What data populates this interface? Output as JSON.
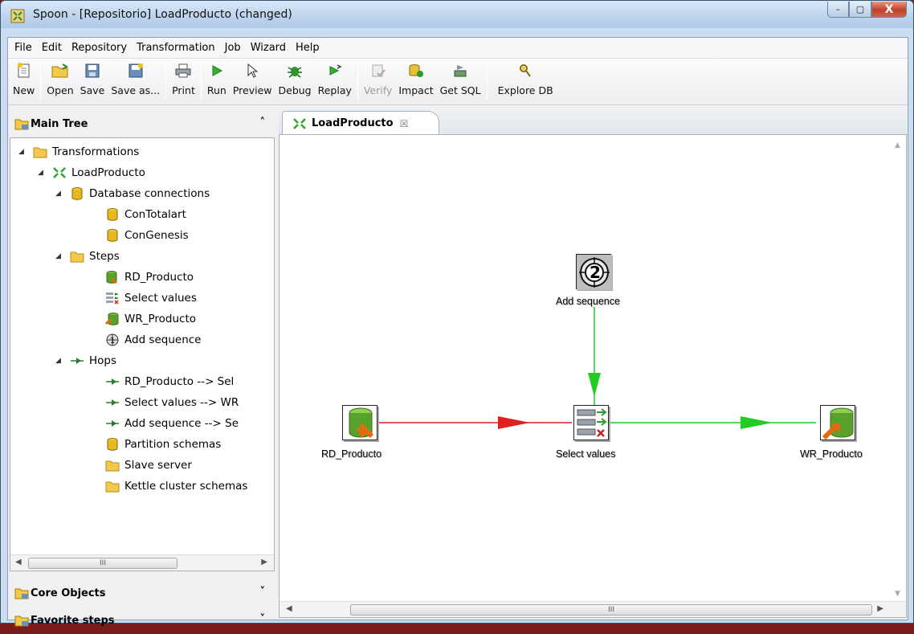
{
  "window": {
    "title": "Spoon - [Repositorio] LoadProducto (changed)",
    "minimize_label": "–",
    "maximize_label": "▢",
    "close_label": "X"
  },
  "menu": [
    {
      "label": "File"
    },
    {
      "label": "Edit"
    },
    {
      "label": "Repository"
    },
    {
      "label": "Transformation"
    },
    {
      "label": "Job"
    },
    {
      "label": "Wizard"
    },
    {
      "label": "Help"
    }
  ],
  "toolbar": {
    "new": "New",
    "open": "Open",
    "save": "Save",
    "save_as": "Save as...",
    "print": "Print",
    "run": "Run",
    "preview": "Preview",
    "debug": "Debug",
    "replay": "Replay",
    "verify": "Verify",
    "impact": "Impact",
    "get_sql": "Get SQL",
    "explore_db": "Explore DB"
  },
  "left_pane": {
    "main_tree": "Main Tree",
    "core_objects": "Core Objects",
    "favorite_steps": "Favorite steps",
    "scroll_thumb": "III"
  },
  "tree": {
    "transformations": "Transformations",
    "load_producto": "LoadProducto",
    "database_connections": "Database connections",
    "con_totalart": "ConTotalart",
    "con_genesis": "ConGenesis",
    "steps": "Steps",
    "rd_producto": "RD_Producto",
    "select_values": "Select values",
    "wr_producto": "WR_Producto",
    "add_sequence": "Add sequence",
    "hops": "Hops",
    "hop1": "RD_Producto --> Sel",
    "hop2": "Select values --> WR",
    "hop3": "Add sequence --> Se",
    "partition_schemas": "Partition schemas",
    "slave_server": "Slave server",
    "kettle_cluster": "Kettle cluster schemas"
  },
  "editor": {
    "tab_label": "LoadProducto",
    "tab_close": "☒",
    "scroll_thumb": "III"
  },
  "canvas": {
    "step_add_sequence": "Add sequence",
    "step_rd_producto": "RD_Producto",
    "step_select_values": "Select values",
    "step_wr_producto": "WR_Producto",
    "hop_colors": {
      "error_hop": "#e02020",
      "ok_hop": "#22cc22"
    }
  }
}
